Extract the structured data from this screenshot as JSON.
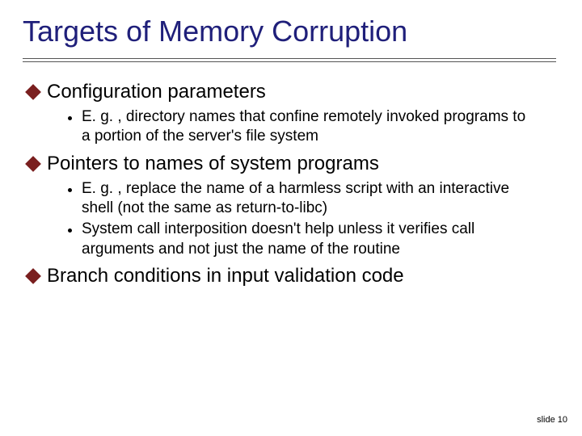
{
  "title": "Targets of Memory Corruption",
  "bullets": {
    "b1": "Configuration parameters",
    "b1_1": "E. g. , directory names that confine remotely invoked programs to a portion of the server's file system",
    "b2": "Pointers to names of system programs",
    "b2_1": "E. g. , replace the name of a harmless script with an interactive shell (not the same as return-to-libc)",
    "b2_2": "System call interposition doesn't help unless it verifies call arguments and not just the name of the routine",
    "b3": "Branch conditions in input validation code"
  },
  "footer": "slide 10"
}
